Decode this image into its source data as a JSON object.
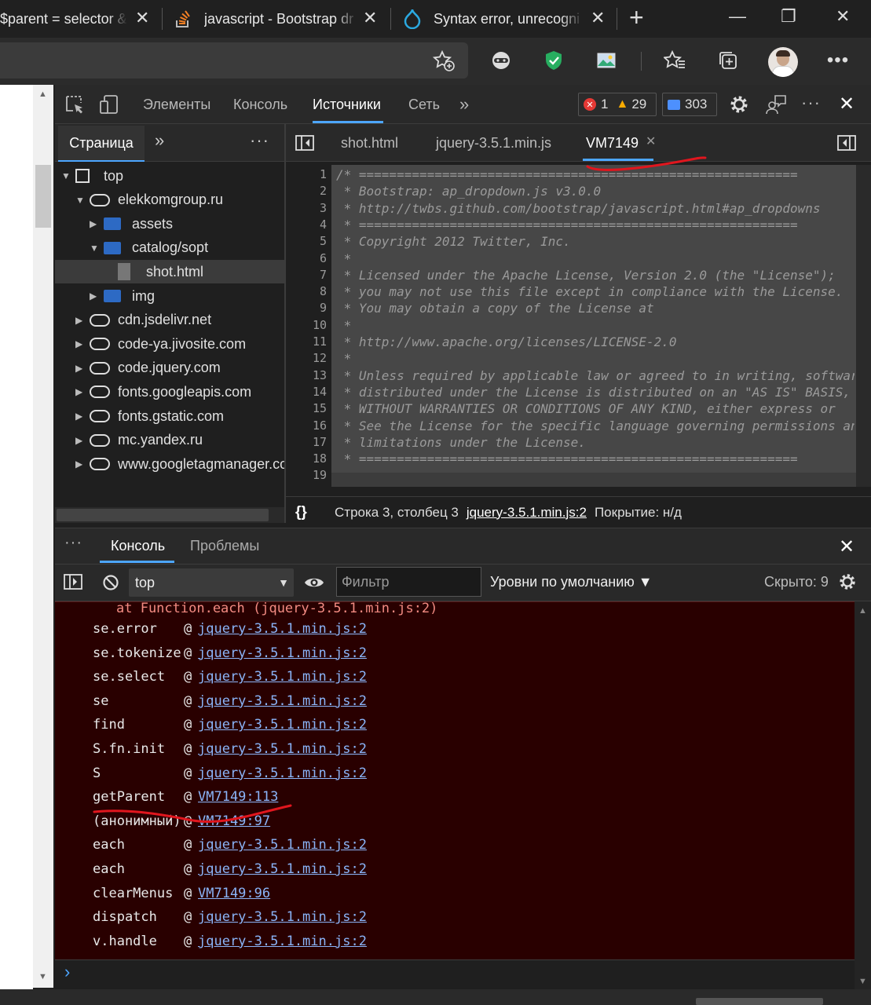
{
  "browser": {
    "tabs": [
      {
        "title": "$parent = selector &"
      },
      {
        "title": "javascript - Bootstrap dr"
      },
      {
        "title": "Syntax error, unrecogni"
      }
    ],
    "new_tab_symbol": "+",
    "close_symbol": "✕",
    "minimize_symbol": "—",
    "restore_symbol": "❐"
  },
  "devtools": {
    "tabs": [
      "Элементы",
      "Консоль",
      "Источники",
      "Сеть"
    ],
    "active_tab": "Источники",
    "more_tabs": "»",
    "errors_count": "1",
    "warnings_count": "29",
    "messages_count": "303",
    "navigator": {
      "page_tab": "Страница",
      "more": "»",
      "menu": "⋮",
      "tree": [
        {
          "label": "top",
          "depth": 0,
          "icon": "frame",
          "arrow": "▼"
        },
        {
          "label": "elekkomgroup.ru",
          "depth": 1,
          "icon": "cloud",
          "arrow": "▼"
        },
        {
          "label": "assets",
          "depth": 2,
          "icon": "folder",
          "arrow": "▶"
        },
        {
          "label": "catalog/sopt",
          "depth": 2,
          "icon": "folder",
          "arrow": "▼"
        },
        {
          "label": "shot.html",
          "depth": 3,
          "icon": "file",
          "arrow": "",
          "selected": true
        },
        {
          "label": "img",
          "depth": 2,
          "icon": "folder",
          "arrow": "▶"
        },
        {
          "label": "cdn.jsdelivr.net",
          "depth": 1,
          "icon": "cloud",
          "arrow": "▶"
        },
        {
          "label": "code-ya.jivosite.com",
          "depth": 1,
          "icon": "cloud",
          "arrow": "▶"
        },
        {
          "label": "code.jquery.com",
          "depth": 1,
          "icon": "cloud",
          "arrow": "▶"
        },
        {
          "label": "fonts.googleapis.com",
          "depth": 1,
          "icon": "cloud",
          "arrow": "▶"
        },
        {
          "label": "fonts.gstatic.com",
          "depth": 1,
          "icon": "cloud",
          "arrow": "▶"
        },
        {
          "label": "mc.yandex.ru",
          "depth": 1,
          "icon": "cloud",
          "arrow": "▶"
        },
        {
          "label": "www.googletagmanager.co",
          "depth": 1,
          "icon": "cloud",
          "arrow": "▶"
        }
      ]
    },
    "editor": {
      "tabs": [
        "shot.html",
        "jquery-3.5.1.min.js",
        "VM7149"
      ],
      "active_tab": "VM7149",
      "lines": [
        "/* ==========================================================",
        " * Bootstrap: ap_dropdown.js v3.0.0",
        " * http://twbs.github.com/bootstrap/javascript.html#ap_dropdowns",
        " * ==========================================================",
        " * Copyright 2012 Twitter, Inc.",
        " *",
        " * Licensed under the Apache License, Version 2.0 (the \"License\");",
        " * you may not use this file except in compliance with the License.",
        " * You may obtain a copy of the License at",
        " *",
        " * http://www.apache.org/licenses/LICENSE-2.0",
        " *",
        " * Unless required by applicable law or agreed to in writing, software",
        " * distributed under the License is distributed on an \"AS IS\" BASIS,",
        " * WITHOUT WARRANTIES OR CONDITIONS OF ANY KIND, either express or",
        " * See the License for the specific language governing permissions and",
        " * limitations under the License.",
        " * ==========================================================",
        ""
      ],
      "status": {
        "braces": "{}",
        "position": "Строка 3, столбец 3",
        "source_link": "jquery-3.5.1.min.js:2",
        "coverage": "Покрытие: н/д"
      }
    },
    "drawer": {
      "menu": "⋮",
      "tabs": [
        "Консоль",
        "Проблемы"
      ],
      "active_tab": "Консоль",
      "context": "top",
      "filter_placeholder": "Фильтр",
      "levels": "Уровни по умолчанию ▼",
      "hidden": "Скрыто: 9",
      "error_line": "at Function.each (jquery-3.5.1.min.js:2)",
      "stack": [
        {
          "fn": "se.error",
          "loc": "jquery-3.5.1.min.js:2"
        },
        {
          "fn": "se.tokenize",
          "loc": "jquery-3.5.1.min.js:2"
        },
        {
          "fn": "se.select",
          "loc": "jquery-3.5.1.min.js:2"
        },
        {
          "fn": "se",
          "loc": "jquery-3.5.1.min.js:2"
        },
        {
          "fn": "find",
          "loc": "jquery-3.5.1.min.js:2"
        },
        {
          "fn": "S.fn.init",
          "loc": "jquery-3.5.1.min.js:2"
        },
        {
          "fn": "S",
          "loc": "jquery-3.5.1.min.js:2"
        },
        {
          "fn": "getParent",
          "loc": "VM7149:113"
        },
        {
          "fn": "(анонимный)",
          "loc": "VM7149:97"
        },
        {
          "fn": "each",
          "loc": "jquery-3.5.1.min.js:2"
        },
        {
          "fn": "each",
          "loc": "jquery-3.5.1.min.js:2"
        },
        {
          "fn": "clearMenus",
          "loc": "VM7149:96"
        },
        {
          "fn": "dispatch",
          "loc": "jquery-3.5.1.min.js:2"
        },
        {
          "fn": "v.handle",
          "loc": "jquery-3.5.1.min.js:2"
        }
      ],
      "prompt": "›"
    }
  },
  "colors": {
    "accent": "#4da6ff",
    "error_bg": "#290000",
    "link": "#8ab4f8",
    "annotation_red": "#e0161e"
  }
}
